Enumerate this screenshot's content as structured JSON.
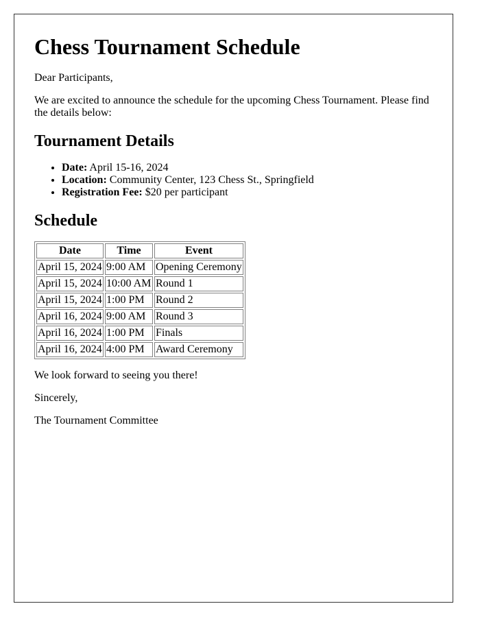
{
  "title": "Chess Tournament Schedule",
  "greeting": "Dear Participants,",
  "intro": "We are excited to announce the schedule for the upcoming Chess Tournament. Please find the details below:",
  "details": {
    "heading": "Tournament Details",
    "items": [
      {
        "label": "Date:",
        "value": " April 15-16, 2024"
      },
      {
        "label": "Location:",
        "value": " Community Center, 123 Chess St., Springfield"
      },
      {
        "label": "Registration Fee:",
        "value": " $20 per participant"
      }
    ]
  },
  "schedule": {
    "heading": "Schedule",
    "columns": [
      "Date",
      "Time",
      "Event"
    ],
    "rows": [
      [
        "April 15, 2024",
        "9:00 AM",
        "Opening Ceremony"
      ],
      [
        "April 15, 2024",
        "10:00 AM",
        "Round 1"
      ],
      [
        "April 15, 2024",
        "1:00 PM",
        "Round 2"
      ],
      [
        "April 16, 2024",
        "9:00 AM",
        "Round 3"
      ],
      [
        "April 16, 2024",
        "1:00 PM",
        "Finals"
      ],
      [
        "April 16, 2024",
        "4:00 PM",
        "Award Ceremony"
      ]
    ]
  },
  "closing": "We look forward to seeing you there!",
  "signoff": "Sincerely,",
  "signature": "The Tournament Committee"
}
